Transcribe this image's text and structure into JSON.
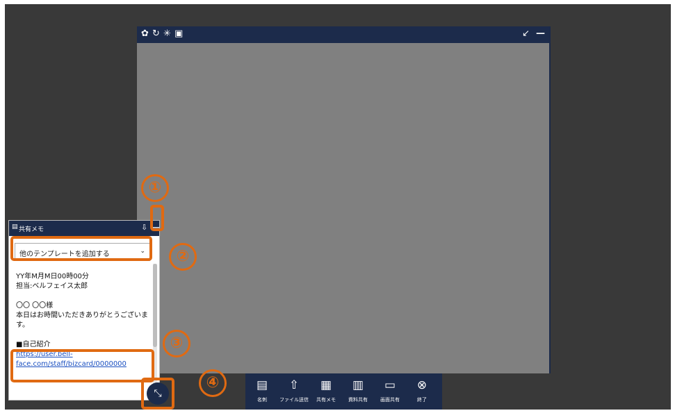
{
  "video_window": {
    "icons": [
      "gear-icon",
      "refresh-icon",
      "brightness-icon",
      "person-icon"
    ],
    "settings_glyph": "✿",
    "refresh_glyph": "↻",
    "brightness_glyph": "✳",
    "person_glyph": "▣",
    "shrink_glyph": "↙",
    "minimize_glyph": "—"
  },
  "memo": {
    "title": "共有メモ",
    "template_select": "他のテンプレートを追加する",
    "lines": [
      "YY年M月M日00時00分",
      "担当:ベルフェイス太郎",
      "",
      "〇〇 〇〇様",
      "本日はお時間いただきありがとうございます。",
      "",
      "■自己紹介"
    ],
    "link": "https://user.bell-face.com/staff/bizcard/0000000"
  },
  "toolbar": {
    "items": [
      {
        "label": "名刺",
        "icon": "business-card-icon",
        "glyph": "▤"
      },
      {
        "label": "ファイル送信",
        "icon": "upload-icon",
        "glyph": "⇧"
      },
      {
        "label": "共有メモ",
        "icon": "memo-icon",
        "glyph": "▦"
      },
      {
        "label": "資料共有",
        "icon": "document-share-icon",
        "glyph": "▥"
      },
      {
        "label": "画面共有",
        "icon": "screen-share-icon",
        "glyph": "▭"
      },
      {
        "label": "終了",
        "icon": "close-circle-icon",
        "glyph": "⊗"
      }
    ]
  },
  "expand_button": {
    "glyph": "⤡"
  },
  "callouts": [
    "①",
    "②",
    "③",
    "④"
  ],
  "colors": {
    "accent": "#e06a12",
    "header": "#1c2b4b",
    "background": "#393939",
    "video": "#808080"
  }
}
